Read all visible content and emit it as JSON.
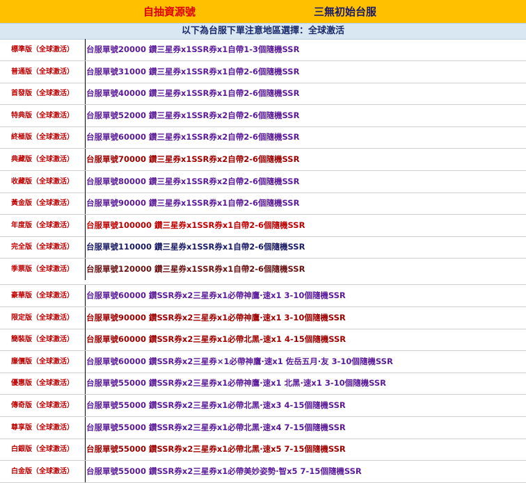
{
  "header": {
    "left": "自抽資源號",
    "right": "三無初始台服"
  },
  "subheader": "以下為台服下單注意地區選擇：全球激活",
  "colors": {
    "header_bg": "#ffc000",
    "subheader_bg": "#d9e7f3",
    "name_red": "#c00000",
    "purple": "#5b1a9a",
    "darkred": "#a00000",
    "navy": "#1a1a66"
  },
  "rows_a": [
    {
      "name": "標準版（全球激活）",
      "desc": "台服單號20000 鑽三星券x1SSR券x1自帶1-3個隨機SSR",
      "color": "#5b1a9a"
    },
    {
      "name": "普通版（全球激活）",
      "desc": "台服單號31000 鑽三星券x1SSR券x1自帶2-6個隨機SSR",
      "color": "#5b1a9a"
    },
    {
      "name": "首發版（全球激活）",
      "desc": "台服單號40000 鑽三星券x1SSR券x1自帶2-6個隨機SSR",
      "color": "#5b1a9a"
    },
    {
      "name": "特典版（全球激活）",
      "desc": "台服單號52000 鑽三星券x1SSR券x2自帶2-6個隨機SSR",
      "color": "#5b1a9a"
    },
    {
      "name": "終極版（全球激活）",
      "desc": "台服單號60000 鑽三星券x1SSR券x2自帶2-6個隨機SSR",
      "color": "#5b1a9a"
    },
    {
      "name": "典藏版（全球激活）",
      "desc": "台服單號70000 鑽三星券x1SSR券x2自帶2-6個隨機SSR",
      "color": "#a00000"
    },
    {
      "name": "收藏版（全球激活）",
      "desc": "台服單號80000 鑽三星券x1SSR券x2自帶2-6個隨機SSR",
      "color": "#5b1a9a"
    },
    {
      "name": "黃金版（全球激活）",
      "desc": "台服單號90000 鑽三星券x1SSR券x1自帶2-6個隨機SSR",
      "color": "#5b1a9a"
    },
    {
      "name": "年度版（全球激活）",
      "desc": "台服單號100000 鑽三星券x1SSR券x1自帶2-6個隨機SSR",
      "color": "#c00000"
    },
    {
      "name": "完全版（全球激活）",
      "desc": "台服單號110000 鑽三星券x1SSR券x1自帶2-6個隨機SSR",
      "color": "#1a1a66"
    },
    {
      "name": "季票版（全球激活）",
      "desc": "台服單號120000 鑽三星券x1SSR券x1自帶2-6個隨機SSR",
      "color": "#6a1010"
    }
  ],
  "rows_b": [
    {
      "name": "豪華版（全球激活）",
      "desc": "台服單號60000 鑽SSR券x2三星券x1必帶神鷹·速x1 3-10個隨機SSR",
      "color": "#5b1a9a"
    },
    {
      "name": "限定版（全球激活）",
      "desc": "台服單號90000 鑽SSR券x2三星券x1必帶神鷹·速x1 3-10個隨機SSR",
      "color": "#a00000"
    },
    {
      "name": "簡裝版（全球激活）",
      "desc": "台服單號60000 鑽SSR券x2三星券x1必帶北黑-速x1 4-15個隨機SSR",
      "color": "#a00000"
    },
    {
      "name": "廉價版（全球激活）",
      "desc": "台服單號60000 鑽SSR券x2三星券×1必帶神鷹·速x1 佐岳五月·友 3-10個隨機SSR",
      "color": "#5b1a9a"
    },
    {
      "name": "優惠版（全球激活）",
      "desc": "台服單號55000 鑽SSR券x2三星券x1必帶神鷹·速x1 北黑·速x1 3-10個隨機SSR",
      "color": "#5b1a9a"
    },
    {
      "name": "傳奇版（全球激活）",
      "desc": "台服單號55000 鑽SSR券x2三星券x1必帶北黑·速x3 4-15個隨機SSR",
      "color": "#5b1a9a"
    },
    {
      "name": "尊享版（全球激活）",
      "desc": "台服單號55000 鑽SSR券x2三星券x1必帶北黑·速x4 7-15個隨機SSR",
      "color": "#5b1a9a"
    },
    {
      "name": "白銀版（全球激活）",
      "desc": "台服單號55000 鑽SSR券x2三星券x1必帶北黑·速x5 7-15個隨機SSR",
      "color": "#a00000"
    },
    {
      "name": "白金版（全球激活）",
      "desc": "台服單號55000 鑽SSR券x2三星券x1必帶美妙姿勢·智x5 7-15個隨機SSR",
      "color": "#5b1a9a"
    }
  ]
}
